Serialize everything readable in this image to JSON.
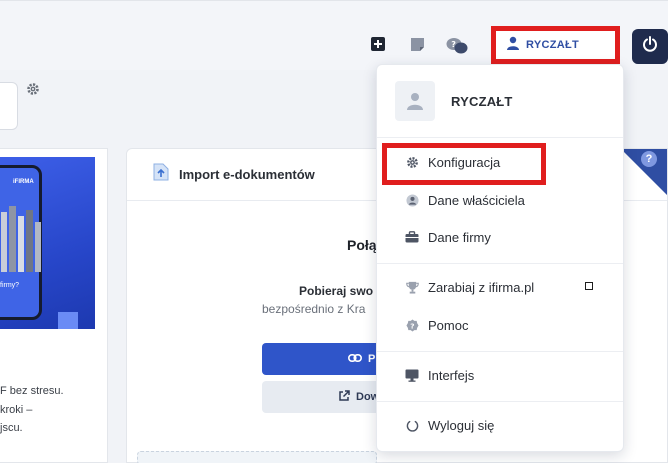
{
  "topbar": {
    "icons": [
      "plus-square-icon",
      "sticky-note-icon",
      "chat-bubbles-icon"
    ],
    "user_label": "RYCZAŁT",
    "power_icon": "power-icon"
  },
  "left_card": {
    "promo_brand": "iFIRMA",
    "promo_question": "firmy?",
    "text_lines": [
      "F bez stresu.",
      "kroki –",
      "jscu."
    ]
  },
  "main_card": {
    "header_title": "Import e-dokumentów",
    "heading": "Połą",
    "sub_bold": "Pobieraj swo",
    "sub_regular": "bezpośrednio z Kra",
    "primary_button": "P",
    "secondary_button": "Dow",
    "help_mark": "?"
  },
  "dropdown": {
    "user_name": "RYCZAŁT",
    "items": [
      {
        "label": "Konfiguracja",
        "icon": "gear-icon"
      },
      {
        "label": "Dane właściciela",
        "icon": "user-circle-icon"
      },
      {
        "label": "Dane firmy",
        "icon": "briefcase-icon"
      },
      {
        "label": "Zarabiaj z ifirma.pl",
        "icon": "trophy-icon"
      },
      {
        "label": "Pomoc",
        "icon": "help-badge-icon"
      },
      {
        "label": "Interfejs",
        "icon": "monitor-icon"
      },
      {
        "label": "Wyloguj się",
        "icon": "logout-icon"
      }
    ]
  },
  "colors": {
    "accent": "#2f4ea3",
    "highlight": "#e01e1e",
    "power_bg": "#1f2b4d"
  }
}
